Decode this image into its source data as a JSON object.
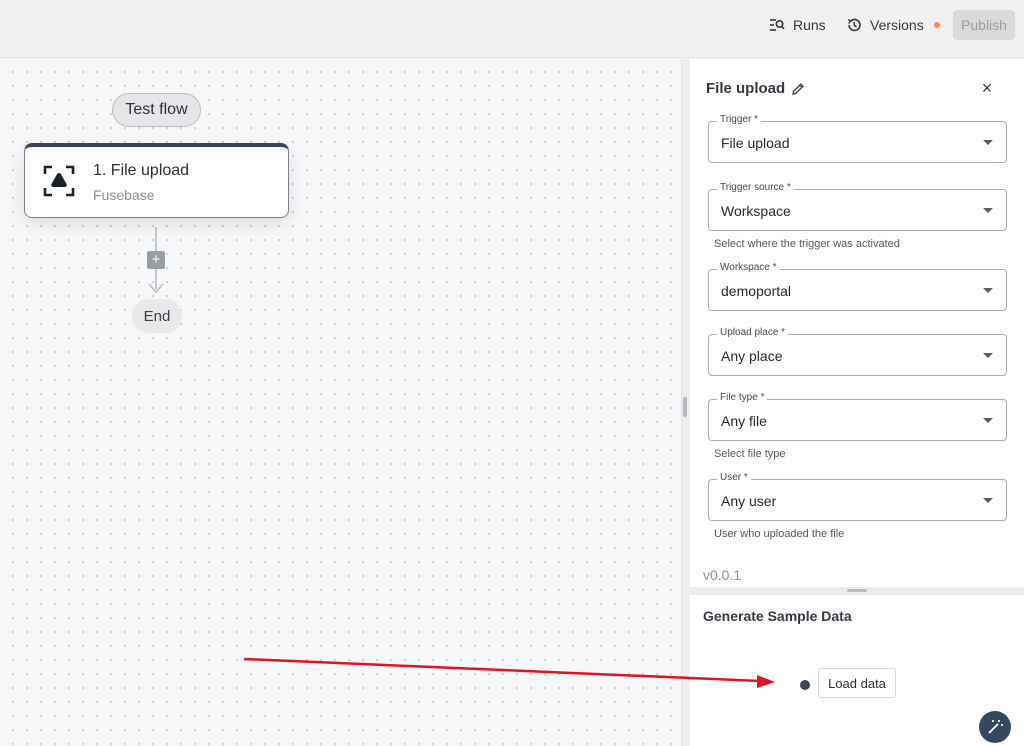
{
  "topbar": {
    "runs_label": "Runs",
    "versions_label": "Versions",
    "publish_label": "Publish",
    "runs_icon": "search-list-icon",
    "versions_icon": "history-icon"
  },
  "canvas": {
    "test_flow_label": "Test flow",
    "step": {
      "title": "1. File upload",
      "subtitle": "Fusebase",
      "icon": "fusebase-logo-icon"
    },
    "add_step_label": "+",
    "end_label": "End"
  },
  "panel": {
    "title": "File upload",
    "fields": [
      {
        "label": "Trigger *",
        "value": "File upload"
      },
      {
        "label": "Trigger source *",
        "value": "Workspace",
        "helper": "Select where the trigger was activated"
      },
      {
        "label": "Workspace *",
        "value": "demoportal"
      },
      {
        "label": "Upload place *",
        "value": "Any place"
      },
      {
        "label": "File type *",
        "value": "Any file",
        "helper": "Select file type"
      },
      {
        "label": "User *",
        "value": "Any user",
        "helper": "User who uploaded the file"
      }
    ],
    "version": "v0.0.1"
  },
  "sample": {
    "title": "Generate Sample Data",
    "load_label": "Load data"
  },
  "colors": {
    "accent_dark": "#34495e",
    "versions_dot": "#ff8a3d",
    "annotation_arrow": "#e0141e"
  }
}
